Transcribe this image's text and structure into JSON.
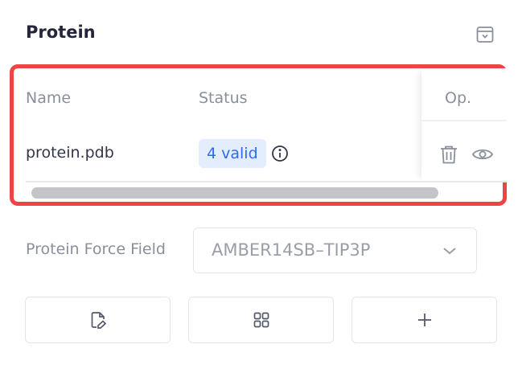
{
  "panel": {
    "title": "Protein",
    "collapse_icon": "collapse-panel-icon"
  },
  "table": {
    "columns": [
      "Name",
      "Status",
      "Op."
    ],
    "rows": [
      {
        "name": "protein.pdb",
        "status": "4 valid",
        "icons": [
          "info-icon",
          "trash-icon",
          "eye-icon"
        ]
      }
    ],
    "scroll_fraction_visible": 0.86
  },
  "force_field": {
    "label": "Protein Force Field",
    "value": "AMBER14SB–TIP3P",
    "chevron_icon": "chevron-down-icon"
  },
  "actions": [
    {
      "icon": "edit-file-icon"
    },
    {
      "icon": "grid-icon"
    },
    {
      "icon": "plus-icon"
    }
  ],
  "colors": {
    "accent": "#2a6df0",
    "badge_bg": "#e3edfd",
    "highlight_border": "#ee4444",
    "muted_text": "#8a8f9c",
    "scroll_thumb": "#c4c5c8"
  }
}
